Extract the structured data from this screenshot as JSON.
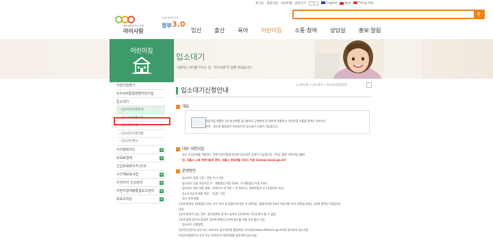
{
  "util_links": [
    "로그인",
    "회원가입",
    "사이트맵",
    "글자크기"
  ],
  "font_size_value": "+",
  "languages": [
    "English",
    "中文",
    "Tiếng Việt"
  ],
  "logo": {
    "subtitle": "육아정책연구소 운영",
    "name": "아이사랑"
  },
  "gov_badge": {
    "small": "국민이 행복한 정부",
    "word": "정부",
    "number": "3.0"
  },
  "search": {
    "placeholder": "",
    "icon": "search-icon"
  },
  "gnb": [
    "임신",
    "출산",
    "육아",
    "어린이집",
    "소통·참여",
    "상담실",
    "홍보·알림"
  ],
  "gnb_active": "어린이집",
  "colors": {
    "accent": "#f0821e",
    "green": "#3e9a6b",
    "red": "#e53935"
  },
  "left_panel": {
    "title": "어린이집",
    "icon": "house-icon"
  },
  "banner": {
    "title": "입소대기",
    "subtitle": "사랑하는 아이를 키우는 일, \"아이사랑\"이 함께 하겠습니다."
  },
  "sidebar": [
    {
      "label": "어린이집찾기",
      "type": "main",
      "plus": false
    },
    {
      "label": "모두GIS통합현황어린이집",
      "type": "main",
      "plus": false
    },
    {
      "label": "입소대기",
      "type": "main",
      "plus": false
    },
    {
      "label": "• 입소대기신청안내",
      "type": "sub",
      "active": true
    },
    {
      "label": "• 입소대기현황조회",
      "type": "sub",
      "boxed": true
    },
    {
      "label": "• 입소대기신청",
      "type": "sub"
    },
    {
      "label": "• 입소대기신청현황",
      "type": "sub"
    },
    {
      "label": "• 입소대기취구",
      "type": "sub"
    },
    {
      "label": "아이행복카드",
      "type": "main",
      "plus": true
    },
    {
      "label": "보육료결제",
      "type": "main",
      "plus": true
    },
    {
      "label": "긴급보육바우처 안내",
      "type": "main",
      "plus": false
    },
    {
      "label": "시간제보육사업",
      "type": "main",
      "plus": true
    },
    {
      "label": "우리아이 건강관리",
      "type": "main",
      "plus": true
    },
    {
      "label": "어린이집재봉통합보고관리",
      "type": "main",
      "plus": true
    },
    {
      "label": "보육교직원",
      "type": "main",
      "plus": true
    }
  ],
  "content": {
    "title": "입소대기신청안내",
    "breadcrumb": "어린이집 > 입소대기 > 입소대기신청안내",
    "sec1": "개요",
    "overview": [
      "어린이집 현황은 입소대기자를 일시관리로 공개하여 등 명하게 관찰하고 어린이집 이용을 원하는 보호자는",
      "지역 · 정소에 제한없이 온라인으로 입소대기 신청이 가능합니다."
    ],
    "sec2": "대상 어린이집",
    "target": [
      "ㆍ 입소 우선순위를 적용하는 전체 어린이집에 대하여 입소대기 신청이 가능합니다. (직장, 협동 어린이집 제외)",
      "ㆍ 단, 서울시 소재 어린이집의 경우, 서울시 보육포털 서비스 이용 (iseoul.seoul.go.kr)"
    ],
    "sec3": "운영방안",
    "ops": [
      "ㆍ 입소대기 등록 시점 : 연중 수시 가능",
      "ㆍ 입소대기 신청 어린이집 수 : 재원중인 아동 2개소, 비 재원중인 아동 3개소",
      "ㆍ 입소대기 대상 아동 범위 : 보육나이 만 0세 ~ 만 5세 (단, 장애아동은 만 12세까지 가능)",
      "ㆍ 입소우선순위 제한 여부 : \"있음\" 기준",
      "ㆍ 입소 순위 배점",
      "  1순위 항목당 100점(단,취소 가구 자녀 및 맞벌이의 경우 각 200점), 맞벌이인데 3자녀 이상이면 추가 100점 부여), 2순위 항목당 50점으로",
      "  산정",
      "  1순위 항목이 있는 경우, 점수합계가 같거나 높아도 1순위보다 우선순위가 될 수 없음",
      "  1순위 항목 점수가 동일한 경우에 한해서 2순위 점수를 적용 추가 합산 가능",
      "ㆍ 입소대기 신청방법",
      "  (온라인신청서) 부모 또는 보호자가 입소자아동 통합포털 아이사랑(www.childcare.go.kr)에 접속하여 입소신청",
      "  (어린이집방문서) 부모 또는 보호자가 어린이집을 방문하여 입소신청"
    ]
  }
}
